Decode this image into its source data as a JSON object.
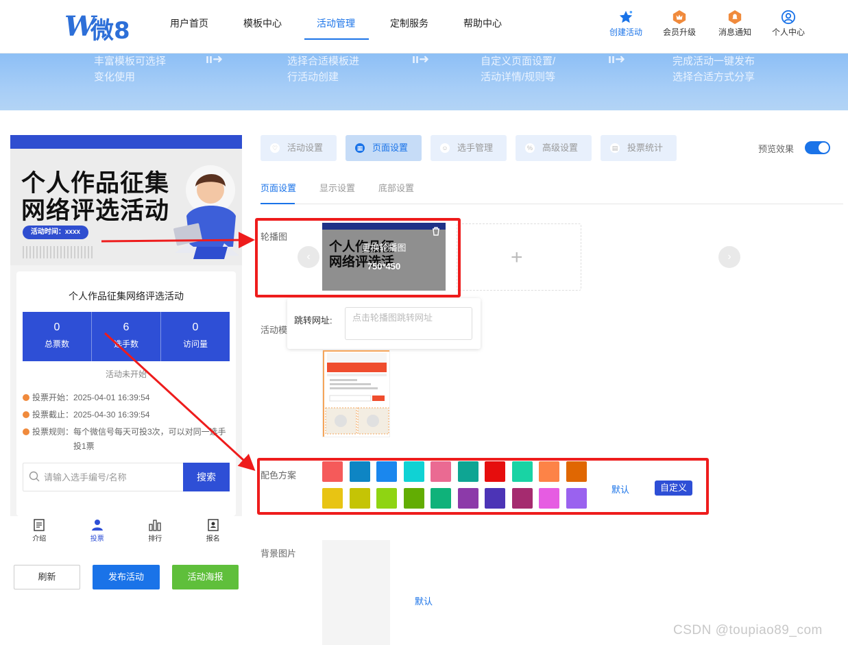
{
  "header": {
    "logo_text": "微8",
    "nav": [
      "用户首页",
      "模板中心",
      "活动管理",
      "定制服务",
      "帮助中心"
    ],
    "active_nav": "活动管理",
    "tools": [
      {
        "label": "创建活动",
        "icon": "star-icon",
        "color": "#1a73e8"
      },
      {
        "label": "会员升级",
        "icon": "crown-badge-icon",
        "color": "#f08a3c"
      },
      {
        "label": "消息通知",
        "icon": "bell-badge-icon",
        "color": "#f08a3c"
      },
      {
        "label": "个人中心",
        "icon": "user-circle-icon",
        "color": "#1a73e8"
      }
    ]
  },
  "banner": [
    {
      "line1": "丰富模板可选择",
      "line2": "变化使用"
    },
    {
      "line1": "选择合适模板进",
      "line2": "行活动创建"
    },
    {
      "line1": "自定义页面设置/",
      "line2": "活动详情/规则等"
    },
    {
      "line1": "完成活动一键发布",
      "line2": "选择合适方式分享"
    }
  ],
  "preview": {
    "poster_title_1": "个人作品征集",
    "poster_title_2": "网络评选活动",
    "poster_time": "活动时间：xxxx",
    "activity_name": "个人作品征集网络评选活动",
    "stats": [
      {
        "value": "0",
        "label": "总票数"
      },
      {
        "value": "6",
        "label": "选手数"
      },
      {
        "value": "0",
        "label": "访问量"
      }
    ],
    "status": "活动未开始",
    "vote_start": "投票开始：2025-04-01 16:39:54",
    "vote_end": "投票截止：2025-04-30 16:39:54",
    "vote_rule_1": "投票规则：每个微信号每天可投3次，可以对同一选手",
    "vote_rule_2": "投1票",
    "search_placeholder": "请输入选手编号/名称",
    "search_button": "搜索",
    "tabbar": [
      "介绍",
      "投票",
      "排行",
      "报名"
    ],
    "active_tab": "投票",
    "btn_refresh": "刷新",
    "btn_publish": "发布活动",
    "btn_poster": "活动海报"
  },
  "settings": {
    "main_tabs": [
      "活动设置",
      "页面设置",
      "选手管理",
      "高级设置",
      "投票统计"
    ],
    "active_main_tab": "页面设置",
    "preview_label": "预览效果",
    "preview_on": true,
    "sub_tabs": [
      "页面设置",
      "显示设置",
      "底部设置"
    ],
    "active_sub_tab": "页面设置",
    "carousel_label": "轮播图",
    "carousel_thumb_title_1": "个人作品征",
    "carousel_thumb_title_2": "网络评选活",
    "carousel_replace": "更换轮播图",
    "carousel_size": "750*450",
    "link_label": "跳转网址:",
    "link_placeholder": "点击轮播图跳转网址",
    "template_label": "活动模",
    "color_label": "配色方案",
    "colors_row1": [
      "#f55a5a",
      "#0e85c4",
      "#1a87ee",
      "#10d2d4",
      "#ea6a92",
      "#0ea593",
      "#e60d0d",
      "#19d3a4",
      "#fd8347",
      "#e06702"
    ],
    "colors_row2": [
      "#e8c413",
      "#c5c405",
      "#8fd412",
      "#62ad03",
      "#0fb27a",
      "#8c3aa9",
      "#4c34b6",
      "#a52b6f",
      "#e65ce2",
      "#9a62ef"
    ],
    "color_default": "默认",
    "color_custom": "自定义",
    "bg_label": "背景图片",
    "bg_default": "默认"
  },
  "watermark": "CSDN @toupiao89_com"
}
